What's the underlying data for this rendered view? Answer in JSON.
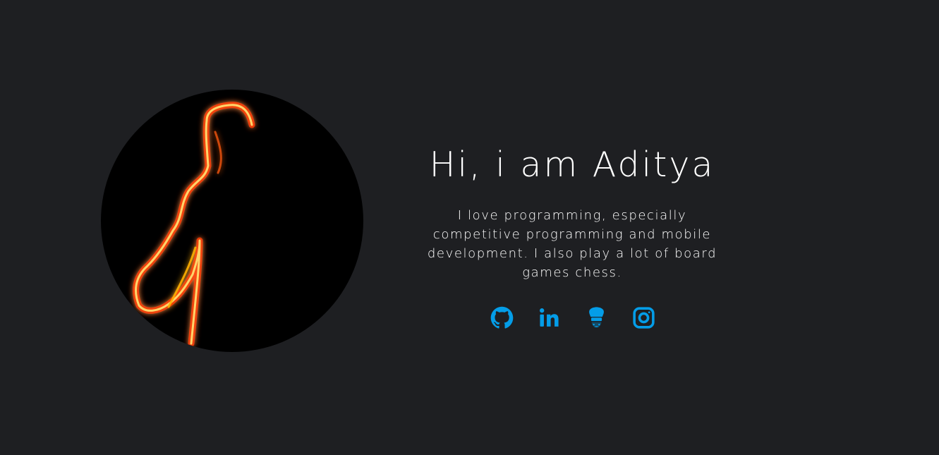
{
  "profile": {
    "avatar_icon": "light-painting-silhouette",
    "heading": "Hi, i am Aditya",
    "bio": "I love programming, especially competitive programming and mobile development. I also play a lot of board games chess."
  },
  "socials": [
    {
      "name": "GitHub",
      "icon": "github-icon"
    },
    {
      "name": "LinkedIn",
      "icon": "linkedin-icon"
    },
    {
      "name": "CodeChef",
      "icon": "codechef-icon"
    },
    {
      "name": "Instagram",
      "icon": "instagram-icon"
    }
  ],
  "colors": {
    "background": "#1e1f22",
    "text": "#ffffff",
    "accent": "#049de8",
    "glow": "#ffb000"
  }
}
